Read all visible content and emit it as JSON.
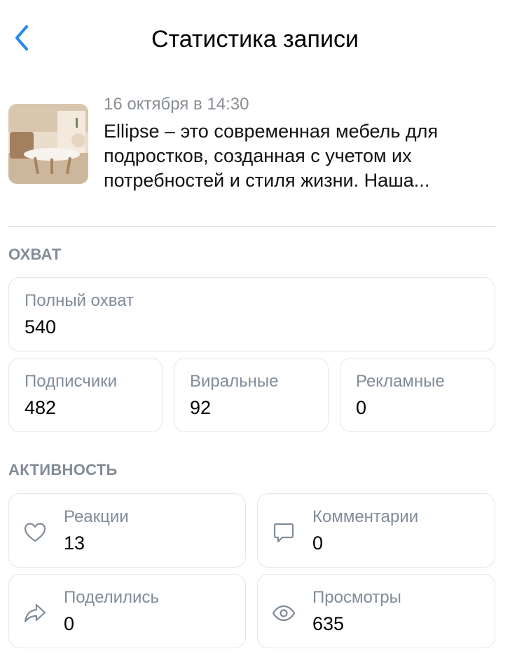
{
  "header": {
    "back_icon": "chevron-left-icon",
    "title": "Статистика записи"
  },
  "post": {
    "thumbnail": "furniture-photo",
    "date": "16 октября в 14:30",
    "text": "Ellipse – это современная мебель для подростков, созданная с учетом их потребностей и стиля жизни. Наша..."
  },
  "reach": {
    "section_title": "ОХВАТ",
    "total": {
      "label": "Полный охват",
      "value": "540"
    },
    "subscribers": {
      "label": "Подписчики",
      "value": "482"
    },
    "viral": {
      "label": "Виральные",
      "value": "92"
    },
    "ads": {
      "label": "Рекламные",
      "value": "0"
    }
  },
  "activity": {
    "section_title": "АКТИВНОСТЬ",
    "reactions": {
      "label": "Реакции",
      "value": "13",
      "icon": "heart-icon"
    },
    "comments": {
      "label": "Комментарии",
      "value": "0",
      "icon": "comment-icon"
    },
    "shares": {
      "label": "Поделились",
      "value": "0",
      "icon": "share-icon"
    },
    "views": {
      "label": "Просмотры",
      "value": "635",
      "icon": "eye-icon"
    }
  },
  "colors": {
    "accent": "#2688eb",
    "secondary_text": "#818c99",
    "card_border": "#e5e6e8"
  }
}
